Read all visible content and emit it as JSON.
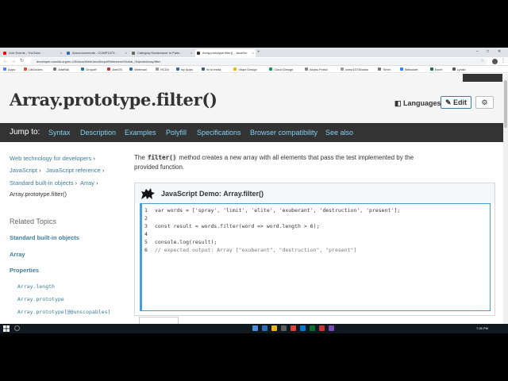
{
  "browser": {
    "tabs": [
      {
        "title": "Live Events - YouTube",
        "fav": "#ff0000"
      },
      {
        "title": "Announcements - COMP1073 -",
        "fav": "#2a6db5"
      },
      {
        "title": "Category:Soulsreaver in Paris - ",
        "fav": "#666666"
      },
      {
        "title": "Array.prototype.filter() - JavaScr",
        "fav": "#333333"
      }
    ],
    "url": "developer.mozilla.org/en-US/docs/Web/JavaScript/Reference/Global_Objects/Array/filter",
    "bookmarks": [
      {
        "label": "Apps",
        "color": "#4285f4"
      },
      {
        "label": "LibGuides",
        "color": "#e34c26"
      },
      {
        "label": "AltaRail",
        "color": "#777777"
      },
      {
        "label": "Dropoff",
        "color": "#2a6db5"
      },
      {
        "label": "AxeOS",
        "color": "#cc3333"
      },
      {
        "label": "Webmail",
        "color": "#2a6db5"
      },
      {
        "label": "HCD4",
        "color": "#999999"
      },
      {
        "label": "my Apps",
        "color": "#2a6db5"
      },
      {
        "label": "fb to meta",
        "color": "#3b5998"
      },
      {
        "label": "Vispe Design",
        "color": "#f4b400"
      },
      {
        "label": "Cloud Design",
        "color": "#0f9d58"
      },
      {
        "label": "Abyss Portal",
        "color": "#888888"
      },
      {
        "label": "comp1073books",
        "color": "#999999"
      },
      {
        "label": "Timer",
        "color": "#777777"
      },
      {
        "label": "Bitbucket",
        "color": "#2684ff"
      },
      {
        "label": "Excel",
        "color": "#1e7145"
      },
      {
        "label": "Lynda",
        "color": "#555555"
      }
    ]
  },
  "page": {
    "title": "Array.prototype.filter()",
    "languages": "Languages",
    "edit": "Edit",
    "gear_icon": "gear-icon"
  },
  "jumpbar": {
    "label": "Jump to:",
    "links": [
      "Syntax",
      "Description",
      "Examples",
      "Polyfill",
      "Specifications",
      "Browser compatibility",
      "See also"
    ]
  },
  "sidebar": {
    "breadcrumbs": [
      "Web technology for developers",
      "JavaScript",
      "JavaScript reference",
      "Standard built-in objects",
      "Array",
      "Array.prototype.filter()"
    ],
    "related_heading": "Related Topics",
    "links": [
      "Standard built-in objects",
      "Array",
      "Properties"
    ],
    "properties": [
      "Array.length",
      "Array.prototype",
      "Array.prototype[@@unscopables]"
    ]
  },
  "main": {
    "intro_before": "The ",
    "intro_code": "filter()",
    "intro_after": " method creates a new array with all elements that pass the test implemented by the provided function.",
    "demo_title": "JavaScript Demo: Array.filter()",
    "code_lines": [
      {
        "n": "1",
        "text": "var words = ['spray', 'limit', 'elite', 'exuberant', 'destruction', 'present'];"
      },
      {
        "n": "2",
        "text": ""
      },
      {
        "n": "3",
        "text": "const result = words.filter(word => word.length > 6);"
      },
      {
        "n": "4",
        "text": ""
      },
      {
        "n": "5",
        "text": "console.log(result);"
      },
      {
        "n": "6",
        "text": "// expected output: Array [\"exuberant\", \"destruction\", \"present\"]"
      }
    ]
  },
  "taskbar": {
    "clock": "7:26 PM"
  }
}
